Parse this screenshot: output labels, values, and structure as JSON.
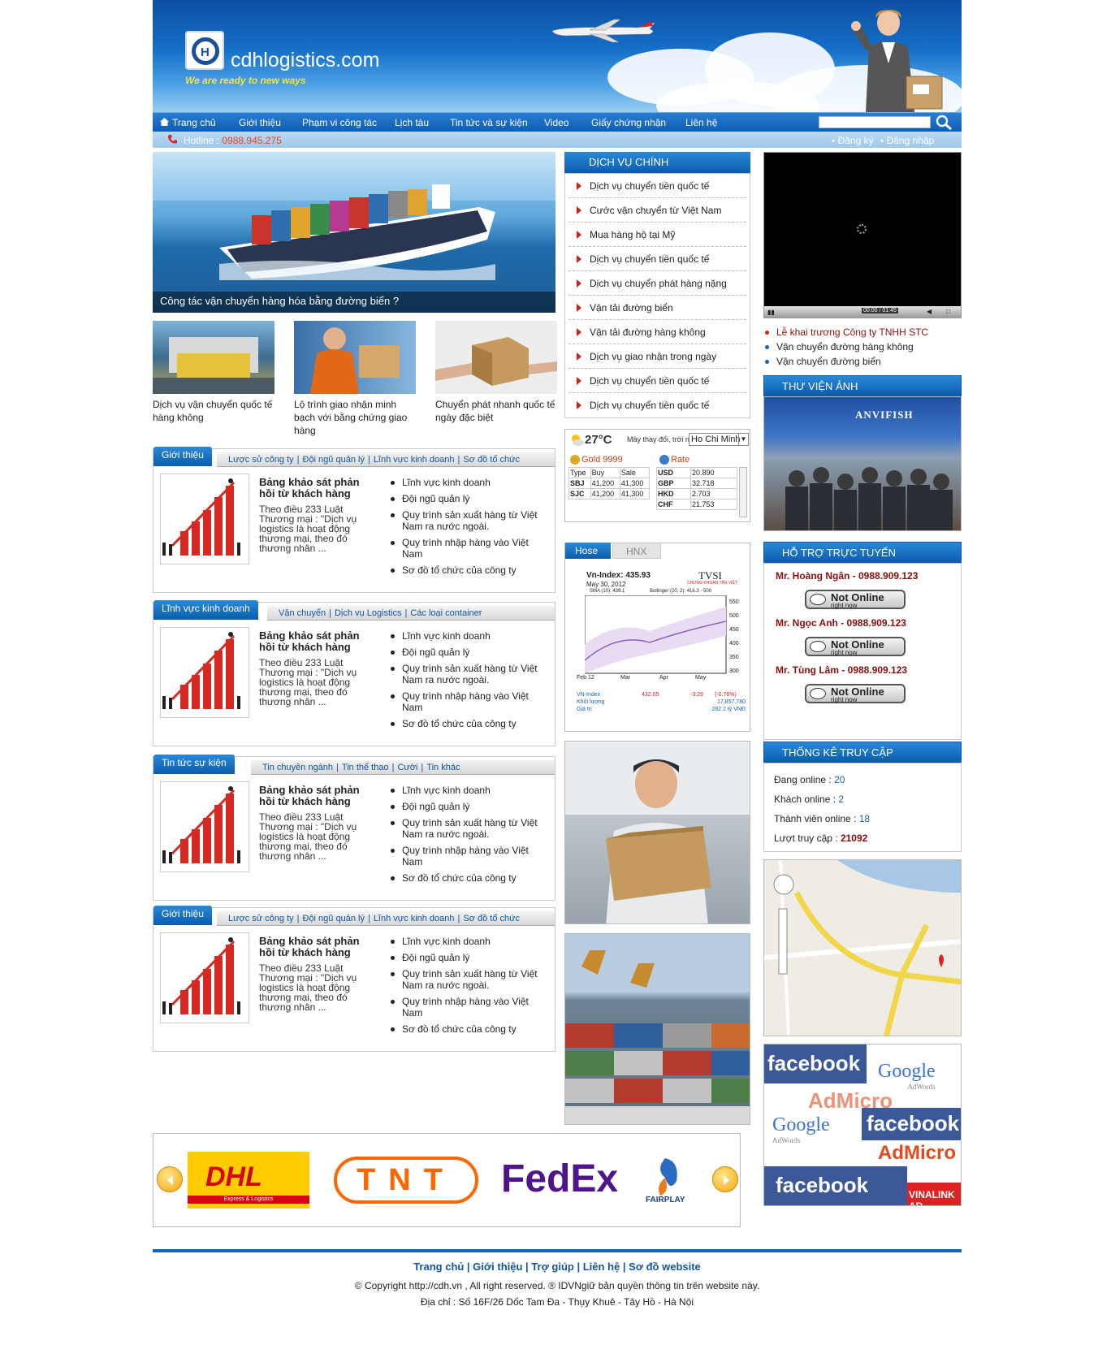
{
  "header": {
    "brand": "cdhlogistics.com",
    "tagline": "We are ready to new ways"
  },
  "nav": {
    "items": [
      "Trang chủ",
      "Giới thiệu",
      "Phạm vi công tác",
      "Lịch tàu",
      "Tin tức và sự kiện",
      "Video",
      "Giấy chứng nhận",
      "Liên hệ"
    ]
  },
  "hotline": {
    "label": "Hotline : ",
    "number": "0988.945.275",
    "register": "Đăng ký",
    "login": "Đăng nhập"
  },
  "hero": {
    "caption": "Công tác vận chuyển hàng hóa bằng đường biển ?"
  },
  "thumbs": [
    {
      "caption": "Dịch vụ vận chuyển quốc tế hàng không"
    },
    {
      "caption": "Lộ trình giao nhận minh bạch với bằng chứng giao hàng"
    },
    {
      "caption": "Chuyển phát nhanh quốc tế ngày đặc biệt"
    }
  ],
  "boxes": [
    {
      "head": "Giới thiệu",
      "tabs": [
        "Lược sử công ty",
        "Đội ngũ quản lý",
        "Lĩnh vực kinh doanh",
        "Sơ đồ tổ chức"
      ],
      "title": "Bảng khảo sát phản hồi từ khách hàng",
      "text": "Theo điều 233 Luật Thương mại : \"Dịch vụ logistics là hoạt động thương mại, theo đó thương nhân ...",
      "list": [
        "Lĩnh vực kinh doanh",
        "Đội ngũ quản lý",
        "Quy trình sản xuất hàng từ Việt Nam ra nước ngoài.",
        "Quy trình nhập hàng vào Việt Nam",
        "Sơ đồ tổ chức của công ty"
      ]
    },
    {
      "head": "Lĩnh vực kinh doanh",
      "tabs": [
        "Vận chuyển",
        "Dịch vụ Logistics",
        "Các loại container"
      ],
      "title": "Bảng khảo sát phản hồi từ khách hàng",
      "text": "Theo điều 233 Luật Thương mại : \"Dịch vụ logistics là hoạt động thương mại, theo đó thương nhân ...",
      "list": [
        "Lĩnh vực kinh doanh",
        "Đội ngũ quản lý",
        "Quy trình sản xuất hàng từ Việt Nam ra nước ngoài.",
        "Quy trình nhập hàng vào Việt Nam",
        "Sơ đồ tổ chức của công ty"
      ]
    },
    {
      "head": "Tin tức sự kiện",
      "tabs": [
        "Tin chuyên ngành",
        "Tin thể thao",
        "Cười",
        "Tin khác"
      ],
      "title": "Bảng khảo sát phản hồi từ khách hàng",
      "text": "Theo điều 233 Luật Thương mại : \"Dịch vụ logistics là hoạt động thương mại, theo đó thương nhân ...",
      "list": [
        "Lĩnh vực kinh doanh",
        "Đội ngũ quản lý",
        "Quy trình sản xuất hàng từ Việt Nam ra nước ngoài.",
        "Quy trình nhập hàng vào Việt Nam",
        "Sơ đồ tổ chức của công ty"
      ]
    },
    {
      "head": "Giới thiệu",
      "tabs": [
        "Lược sử công ty",
        "Đội ngũ quản lý",
        "Lĩnh vực kinh doanh",
        "Sơ đồ tổ chức"
      ],
      "title": "Bảng khảo sát phản hồi từ khách hàng",
      "text": "Theo điều 233 Luật Thương mại : \"Dịch vụ logistics là hoạt động thương mại, theo đó thương nhân ...",
      "list": [
        "Lĩnh vực kinh doanh",
        "Đội ngũ quản lý",
        "Quy trình sản xuất hàng từ Việt Nam ra nước ngoài.",
        "Quy trình nhập hàng vào Việt Nam",
        "Sơ đồ tổ chức của công ty"
      ]
    }
  ],
  "services": {
    "title": "DỊCH VỤ CHÍNH",
    "items": [
      "Dịch vụ chuyển tiền quốc tế",
      "Cước vận chuyển từ Việt Nam",
      "Mua hàng hộ tại Mỹ",
      "Dịch vụ chuyển tiền quốc tế",
      "Dịch vụ chuyển phát hàng nặng",
      "Vận tải đường biển",
      "Vận tải đường hàng không",
      "Dịch vụ giao nhận trong ngày",
      "Dịch vụ chuyển tiền quốc tế",
      "Dịch vụ chuyển tiền quốc tế"
    ]
  },
  "weather": {
    "temp": "27°C",
    "desc": "Mây thay đổi, trời nắng.",
    "city": "Ho Chi Minh"
  },
  "gold": {
    "title": "Gold 9999",
    "cols": [
      "Type",
      "Buy",
      "Sale"
    ],
    "rows": [
      [
        "SBJ",
        "41,200",
        "41,300"
      ],
      [
        "SJC",
        "41,200",
        "41,300"
      ]
    ]
  },
  "rate": {
    "title": "Rate",
    "rows": [
      [
        "USD",
        "20.890"
      ],
      [
        "GBP",
        "32.718"
      ],
      [
        "HKD",
        "2.703"
      ],
      [
        "CHF",
        "21.753"
      ]
    ]
  },
  "stock": {
    "tabs": [
      "Hose",
      "HNX"
    ],
    "title": "Vn-Index: 435.93",
    "date": "May 30, 2012",
    "brand": "TVSI",
    "brand_sub": "CHỨNG KHOÁN TÂN VIỆT",
    "legend1": "SMA (10): 439.1",
    "legend2": "Bollinger (20, 2): 416.3 - 500",
    "yticks": [
      "550",
      "500",
      "450",
      "400",
      "350",
      "300"
    ],
    "xticks": [
      "Feb 12",
      "Mar",
      "Apr",
      "May"
    ],
    "rows": [
      {
        "label": "VN-Index",
        "value": "432.05",
        "change": "-3.29",
        "pct": "(-0.76%)"
      },
      {
        "label": "Khối lượng",
        "value": "17,857,780"
      },
      {
        "label": "Giá trị",
        "value": "282.2 tỷ VNĐ"
      }
    ]
  },
  "news": [
    {
      "text": "Lễ khai trương Công ty TNHH STC",
      "color": "#8a0e0e"
    },
    {
      "text": "Vận chuyển đường hàng không",
      "color": "#222"
    },
    {
      "text": "Vận chuyển đường biển",
      "color": "#222"
    }
  ],
  "video": {
    "time": "00:00 / 01:45"
  },
  "gallery": {
    "title": "THƯ VIỆN ẢNH",
    "banner": "ANVIFISH"
  },
  "support": {
    "title": "HỖ TRỢ TRỰC TUYẾN",
    "people": [
      "Mr. Hoàng Ngân - 0988.909.123",
      "Mr. Ngọc Anh - 0988.909.123",
      "Mr. Tùng Lâm - 0988.909.123"
    ],
    "status": "Not Online",
    "status_sub": "right now"
  },
  "stats": {
    "title": "THỐNG KÊ TRUY CẬP",
    "online_label": "Đang online : ",
    "online": "20",
    "guest_label": "Khách online : ",
    "guest": "2",
    "member_label": "Thành viên online : ",
    "member": "18",
    "visits_label": "Lượt truy cập : ",
    "visits": "21092"
  },
  "ads": {
    "facebook": "facebook",
    "google": "Google",
    "adwords": "AdWords",
    "admicro": "AdMicro",
    "vinalink": "VINALINK AD"
  },
  "partners": [
    "DHL",
    "TNT",
    "FedEx",
    "FAIRPLAY"
  ],
  "partners_sub": {
    "dhl": "Express & Logistics"
  },
  "footer": {
    "links": "Trang chủ | Giới thiệu | Trợ giúp | Liên hệ | Sơ đồ website",
    "copy": "© Copyright http://cdh.vn , All right reserved. ® IDVNgiữ bản quyền thông tin trên website này.",
    "addr": "Địa chỉ : Số 16F/26 Dốc Tam Đa - Thụy Khuê - Tây Hồ - Hà Nội"
  },
  "colors": {
    "primary": "#0b5cae",
    "accent_red": "#c8241c",
    "hotline": "#e8451c"
  }
}
